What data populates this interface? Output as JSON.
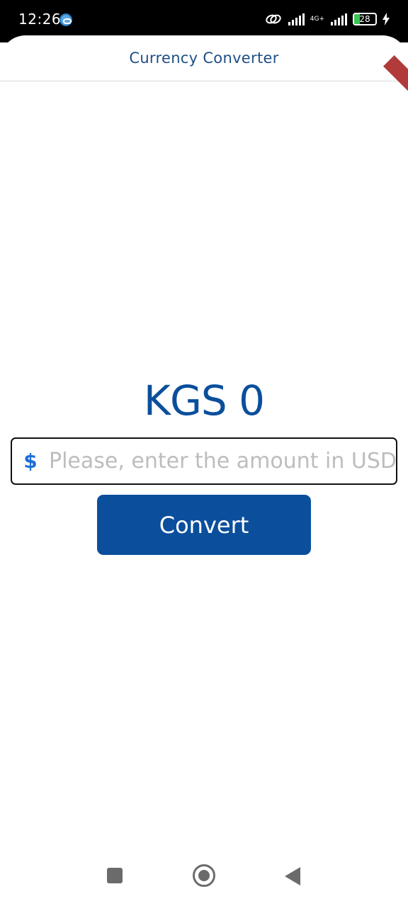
{
  "status_bar": {
    "time": "12:26",
    "network_label": "4G+",
    "battery_level": "28",
    "battery_fraction": 0.28,
    "icons": [
      "sync-icon",
      "link-icon",
      "signal-icon",
      "signal-icon",
      "battery-icon",
      "charging-bolt-icon"
    ]
  },
  "app_bar": {
    "title": "Currency Converter"
  },
  "converter": {
    "result_text": "KGS 0",
    "input_prefix": "$",
    "input_value": "",
    "input_placeholder": "Please, enter the amount in USD",
    "convert_label": "Convert"
  },
  "nav_bar": {
    "icons": [
      "recents-icon",
      "home-icon",
      "back-icon"
    ]
  },
  "colors": {
    "primary": "#0b4f9c",
    "title": "#1f4f86",
    "prefix_icon": "#1d6ed8",
    "placeholder": "#bdbdbd",
    "battery_fill": "#37c853"
  }
}
